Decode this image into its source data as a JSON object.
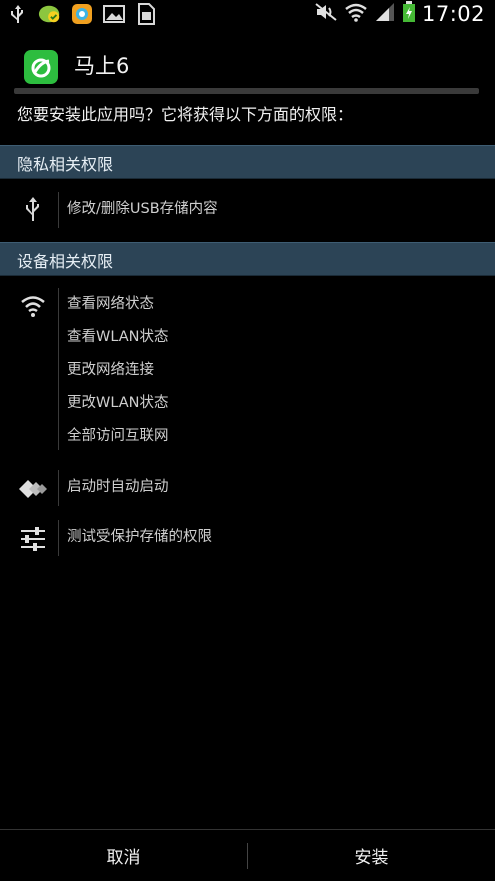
{
  "status_bar": {
    "time": "17:02",
    "left_icons": [
      "usb-icon",
      "app-notification-icon",
      "browser-icon",
      "image-icon",
      "sim-icon"
    ],
    "right_icons": [
      "mute-icon",
      "wifi-icon",
      "signal-icon",
      "battery-icon"
    ]
  },
  "app": {
    "name": "马上6",
    "icon": "app-logo-icon",
    "icon_color": "#2dbd3f"
  },
  "prompt": "您要安装此应用吗？它将获得以下方面的权限：",
  "sections": [
    {
      "title": "隐私相关权限",
      "groups": [
        {
          "icon": "usb-icon",
          "permissions": [
            "修改/删除USB存储内容"
          ]
        }
      ]
    },
    {
      "title": "设备相关权限",
      "groups": [
        {
          "icon": "wifi-icon",
          "permissions": [
            "查看网络状态",
            "查看WLAN状态",
            "更改网络连接",
            "更改WLAN状态",
            "全部访问互联网"
          ]
        },
        {
          "icon": "startup-arrows-icon",
          "permissions": [
            "启动时自动启动"
          ]
        },
        {
          "icon": "sliders-icon",
          "permissions": [
            "测试受保护存储的权限"
          ]
        }
      ]
    }
  ],
  "buttons": {
    "cancel": "取消",
    "install": "安装"
  },
  "colors": {
    "section_header": "#2c4456",
    "background": "#000000"
  }
}
